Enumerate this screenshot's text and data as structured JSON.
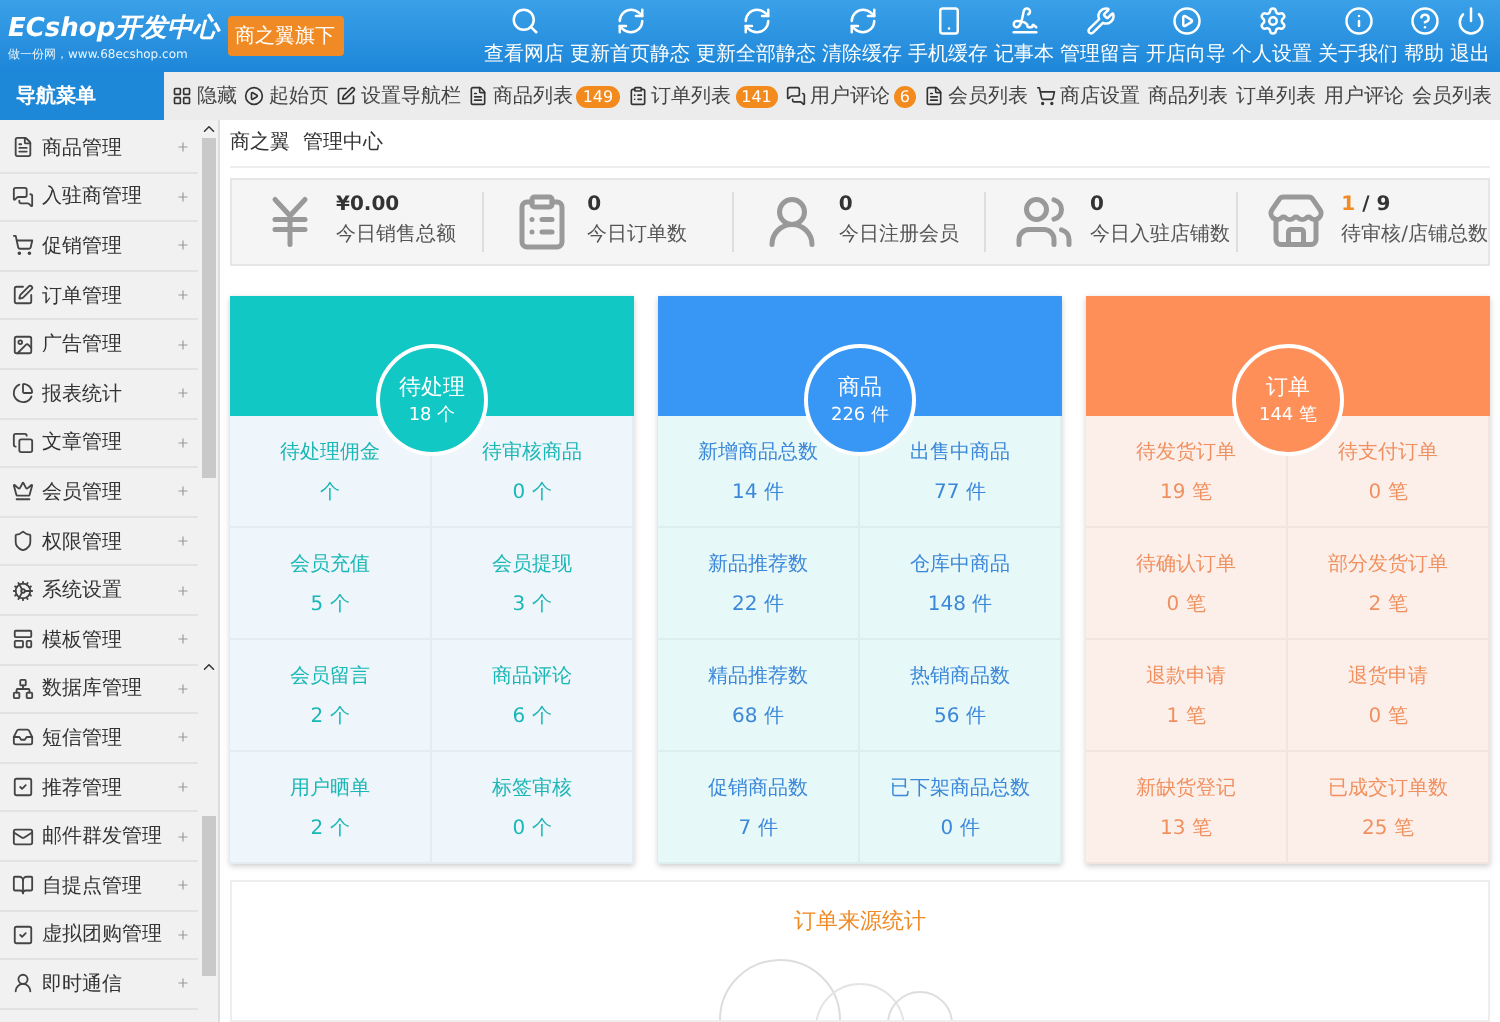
{
  "header": {
    "logo": "ECshop开发中心",
    "logo_tagline": "做一份网，www.68ecshop.com",
    "brand_badge": "商之翼旗下",
    "actions": [
      {
        "label": "查看网店",
        "kind": "search"
      },
      {
        "label": "更新首页静态",
        "kind": "refresh"
      },
      {
        "label": "更新全部静态",
        "kind": "refresh"
      },
      {
        "label": "清除缓存",
        "kind": "refresh"
      },
      {
        "label": "手机缓存",
        "kind": "phone"
      },
      {
        "label": "记事本",
        "kind": "note"
      },
      {
        "label": "管理留言",
        "kind": "wrench"
      },
      {
        "label": "开店向导",
        "kind": "play"
      },
      {
        "label": "个人设置",
        "kind": "gear"
      },
      {
        "label": "关于我们",
        "kind": "info"
      },
      {
        "label": "帮助",
        "kind": "help"
      },
      {
        "label": "退出",
        "kind": "power"
      }
    ]
  },
  "nav_title": "导航菜单",
  "tabs": [
    {
      "label": "隐藏",
      "kind": "grid"
    },
    {
      "label": "起始页",
      "kind": "play"
    },
    {
      "label": "设置导航栏",
      "kind": "edit"
    },
    {
      "label": "商品列表",
      "kind": "doc",
      "badge": "149"
    },
    {
      "label": "订单列表",
      "kind": "clip",
      "badge": "141"
    },
    {
      "label": "用户评论",
      "kind": "chat",
      "badge": "6"
    },
    {
      "label": "会员列表",
      "kind": "doc"
    },
    {
      "label": "商店设置",
      "kind": "cart"
    },
    {
      "label": "商品列表",
      "kind": "plain"
    },
    {
      "label": "订单列表",
      "kind": "plain"
    },
    {
      "label": "用户评论",
      "kind": "plain"
    },
    {
      "label": "会员列表",
      "kind": "plain"
    }
  ],
  "sidebar": {
    "items": [
      {
        "label": "商品管理",
        "kind": "doc"
      },
      {
        "label": "入驻商管理",
        "kind": "chat"
      },
      {
        "label": "促销管理",
        "kind": "cart"
      },
      {
        "label": "订单管理",
        "kind": "edit"
      },
      {
        "label": "广告管理",
        "kind": "image"
      },
      {
        "label": "报表统计",
        "kind": "pie"
      },
      {
        "label": "文章管理",
        "kind": "copy"
      },
      {
        "label": "会员管理",
        "kind": "vip"
      },
      {
        "label": "权限管理",
        "kind": "shield"
      },
      {
        "label": "系统设置",
        "kind": "gear"
      },
      {
        "label": "模板管理",
        "kind": "layout"
      },
      {
        "label": "数据库管理",
        "kind": "net"
      },
      {
        "label": "短信管理",
        "kind": "inbox"
      },
      {
        "label": "推荐管理",
        "kind": "check"
      },
      {
        "label": "邮件群发管理",
        "kind": "mail"
      },
      {
        "label": "自提点管理",
        "kind": "book"
      },
      {
        "label": "虚拟团购管理",
        "kind": "check"
      },
      {
        "label": "即时通信",
        "kind": "user"
      }
    ]
  },
  "breadcrumb": "商之翼  管理中心",
  "stats": [
    {
      "value": "¥0.00",
      "label": "今日销售总额",
      "kind": "yen"
    },
    {
      "value": "0",
      "label": "今日订单数",
      "kind": "clip"
    },
    {
      "value": "0",
      "label": "今日注册会员",
      "kind": "user"
    },
    {
      "value": "0",
      "label": "今日入驻店铺数",
      "kind": "users"
    },
    {
      "value": "1",
      "value_total": "/ 9",
      "label": "待审核/店铺总数",
      "kind": "store"
    }
  ],
  "panels": [
    {
      "kind": "pending",
      "title": "待处理",
      "count": "18 个",
      "cells": [
        {
          "label": "待处理佣金",
          "value": "个"
        },
        {
          "label": "待审核商品",
          "value": "0 个"
        },
        {
          "label": "会员充值",
          "value": "5 个"
        },
        {
          "label": "会员提现",
          "value": "3 个"
        },
        {
          "label": "会员留言",
          "value": "2 个"
        },
        {
          "label": "商品评论",
          "value": "6 个"
        },
        {
          "label": "用户晒单",
          "value": "2 个"
        },
        {
          "label": "标签审核",
          "value": "0 个"
        }
      ]
    },
    {
      "kind": "goods",
      "title": "商品",
      "count": "226 件",
      "cells": [
        {
          "label": "新增商品总数",
          "value": "14 件"
        },
        {
          "label": "出售中商品",
          "value": "77 件"
        },
        {
          "label": "新品推荐数",
          "value": "22 件"
        },
        {
          "label": "仓库中商品",
          "value": "148 件"
        },
        {
          "label": "精品推荐数",
          "value": "68 件"
        },
        {
          "label": "热销商品数",
          "value": "56 件"
        },
        {
          "label": "促销商品数",
          "value": "7 件"
        },
        {
          "label": "已下架商品总数",
          "value": "0 件"
        }
      ]
    },
    {
      "kind": "orders",
      "title": "订单",
      "count": "144 笔",
      "cells": [
        {
          "label": "待发货订单",
          "value": "19 笔"
        },
        {
          "label": "待支付订单",
          "value": "0 笔"
        },
        {
          "label": "待确认订单",
          "value": "0 笔"
        },
        {
          "label": "部分发货订单",
          "value": "2 笔"
        },
        {
          "label": "退款申请",
          "value": "1 笔"
        },
        {
          "label": "退货申请",
          "value": "0 笔"
        },
        {
          "label": "新缺货登记",
          "value": "13 笔"
        },
        {
          "label": "已成交订单数",
          "value": "25 笔"
        }
      ]
    }
  ],
  "source_card": {
    "title": "订单来源统计"
  }
}
